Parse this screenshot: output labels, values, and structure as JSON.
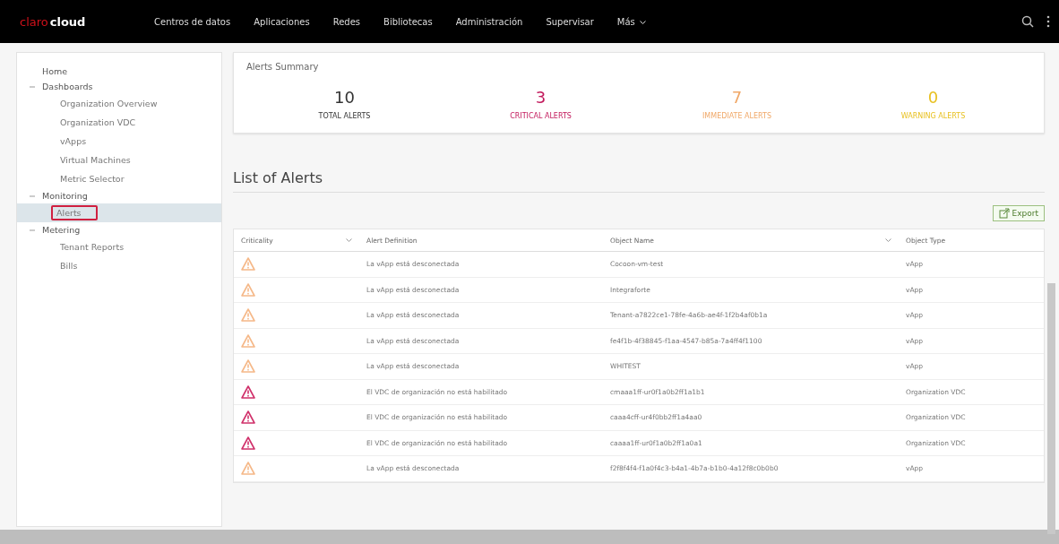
{
  "top_bar": {
    "logo": {
      "brand": "claro",
      "product": "cloud"
    },
    "menu": [
      {
        "label": "Centros de datos",
        "dropdown": false
      },
      {
        "label": "Aplicaciones",
        "dropdown": false
      },
      {
        "label": "Redes",
        "dropdown": false
      },
      {
        "label": "Bibliotecas",
        "dropdown": false
      },
      {
        "label": "Administración",
        "dropdown": false
      },
      {
        "label": "Supervisar",
        "dropdown": false
      },
      {
        "label": "Más",
        "dropdown": true
      }
    ]
  },
  "sidebar": {
    "items": [
      {
        "label": "Home"
      },
      {
        "label": "Dashboards",
        "expanded": true,
        "children": [
          {
            "label": "Organization Overview",
            "selected": false
          },
          {
            "label": "Organization VDC",
            "selected": false
          },
          {
            "label": "vApps",
            "selected": false
          },
          {
            "label": "Virtual Machines",
            "selected": false
          },
          {
            "label": "Metric Selector",
            "selected": false
          }
        ]
      },
      {
        "label": "Monitoring",
        "expanded": true,
        "children": [
          {
            "label": "Alerts",
            "selected": true
          }
        ]
      },
      {
        "label": "Metering",
        "expanded": true,
        "children": [
          {
            "label": "Tenant Reports",
            "selected": false
          },
          {
            "label": "Bills",
            "selected": false
          }
        ]
      }
    ]
  },
  "summary": {
    "title": "Alerts Summary",
    "stats": [
      {
        "value": "10",
        "label": "TOTAL ALERTS",
        "color": "#333333"
      },
      {
        "value": "3",
        "label": "CRITICAL ALERTS",
        "color": "#c2185b"
      },
      {
        "value": "7",
        "label": "IMMEDIATE ALERTS",
        "color": "#f0a868"
      },
      {
        "value": "0",
        "label": "WARNING ALERTS",
        "color": "#e8c020"
      }
    ]
  },
  "alerts": {
    "title": "List of Alerts",
    "export_button": "Export",
    "columns": [
      {
        "label": "Criticality",
        "sortable": true
      },
      {
        "label": "Alert Definition",
        "sortable": false
      },
      {
        "label": "Object Name",
        "sortable": true
      },
      {
        "label": "Object Type",
        "sortable": false
      }
    ],
    "rows": [
      {
        "kind": "immediate",
        "definition": "La vApp está desconectada",
        "object_name": "Cocoon-vm-test",
        "object_type": "vApp"
      },
      {
        "kind": "immediate",
        "definition": "La vApp está desconectada",
        "object_name": "Integraforte",
        "object_type": "vApp"
      },
      {
        "kind": "immediate",
        "definition": "La vApp está desconectada",
        "object_name": "Tenant-a7822ce1-78fe-4a6b-ae4f-1f2b4af0b1a",
        "object_type": "vApp"
      },
      {
        "kind": "immediate",
        "definition": "La vApp está desconectada",
        "object_name": "fe4f1b-4f38845-f1aa-4547-b85a-7a4ff4f1100",
        "object_type": "vApp"
      },
      {
        "kind": "immediate",
        "definition": "La vApp está desconectada",
        "object_name": "WHITEST",
        "object_type": "vApp"
      },
      {
        "kind": "critical",
        "definition": "El VDC de organización no está habilitado",
        "object_name": "cmaaa1ff-ur0f1a0b2ff1a1b1",
        "object_type": "Organization VDC"
      },
      {
        "kind": "critical",
        "definition": "El VDC de organización no está habilitado",
        "object_name": "caaa4cff-ur4f0bb2ff1a4aa0",
        "object_type": "Organization VDC"
      },
      {
        "kind": "critical",
        "definition": "El VDC de organización no está habilitado",
        "object_name": "caaaa1ff-ur0f1a0b2ff1a0a1",
        "object_type": "Organization VDC"
      },
      {
        "kind": "immediate",
        "definition": "La vApp está desconectada",
        "object_name": "f2f8f4f4-f1a0f4c3-b4a1-4b7a-b1b0-4a12f8c0b0b0",
        "object_type": "vApp"
      }
    ]
  }
}
